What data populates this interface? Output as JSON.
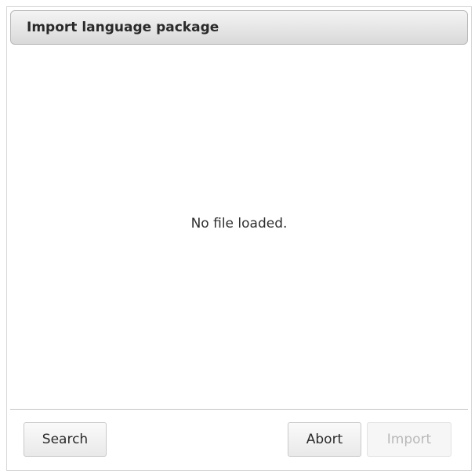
{
  "dialog": {
    "title": "Import language package",
    "empty_message": "No file loaded."
  },
  "buttons": {
    "search": {
      "label": "Search",
      "enabled": true
    },
    "abort": {
      "label": "Abort",
      "enabled": true
    },
    "import": {
      "label": "Import",
      "enabled": false
    }
  },
  "colors": {
    "titlebar_top": "#f4f4f4",
    "titlebar_bottom": "#d9d9d9",
    "disabled_text": "#b9b9b9"
  }
}
